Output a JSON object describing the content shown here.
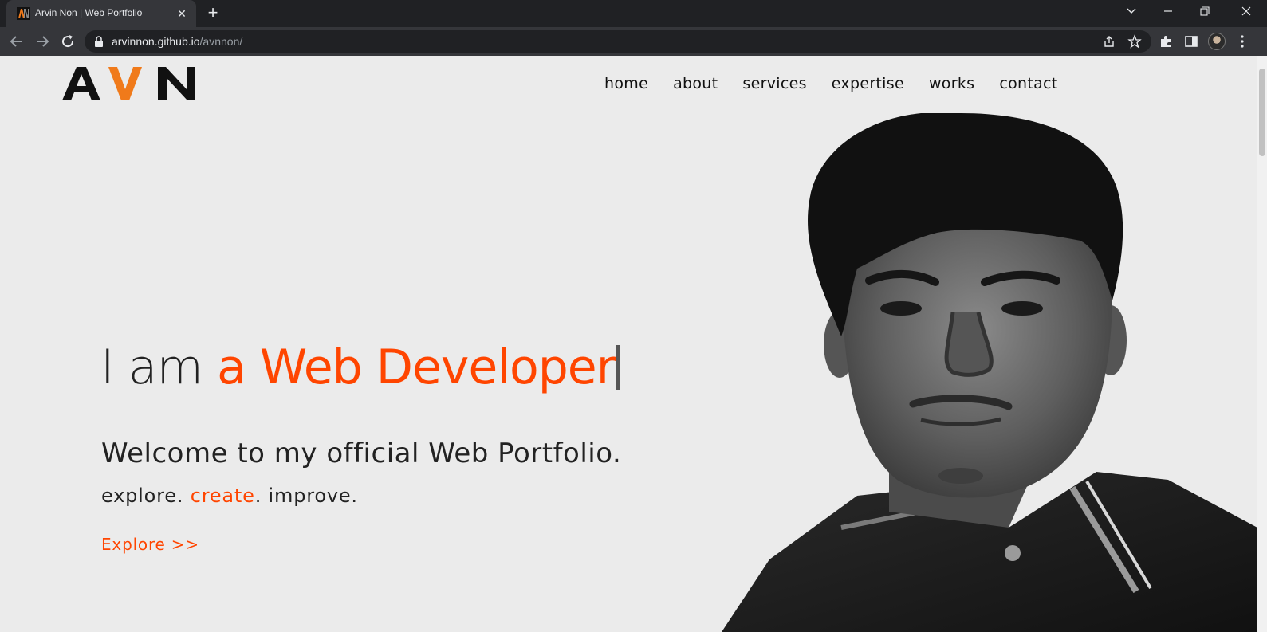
{
  "browser": {
    "tab_title": "Arvin Non | Web Portfolio",
    "tab_close": "✕",
    "new_tab": "+",
    "url_host": "arvinnon.github.io",
    "url_path": "/avnnon/"
  },
  "site": {
    "logo": "AVN",
    "nav": [
      "home",
      "about",
      "services",
      "expertise",
      "works",
      "contact"
    ],
    "hero": {
      "headline_prefix": "I am ",
      "headline_accent": "a Web Developer",
      "welcome": "Welcome to my official Web Portfolio.",
      "tagline_1": "explore. ",
      "tagline_accent": "create",
      "tagline_2": ". improve.",
      "cta": "Explore >>"
    }
  },
  "colors": {
    "accent": "#ff4500",
    "logo_accent": "#f07a1a",
    "page_bg": "#ebebeb",
    "chrome_dark": "#202124",
    "chrome_mid": "#35363a"
  }
}
